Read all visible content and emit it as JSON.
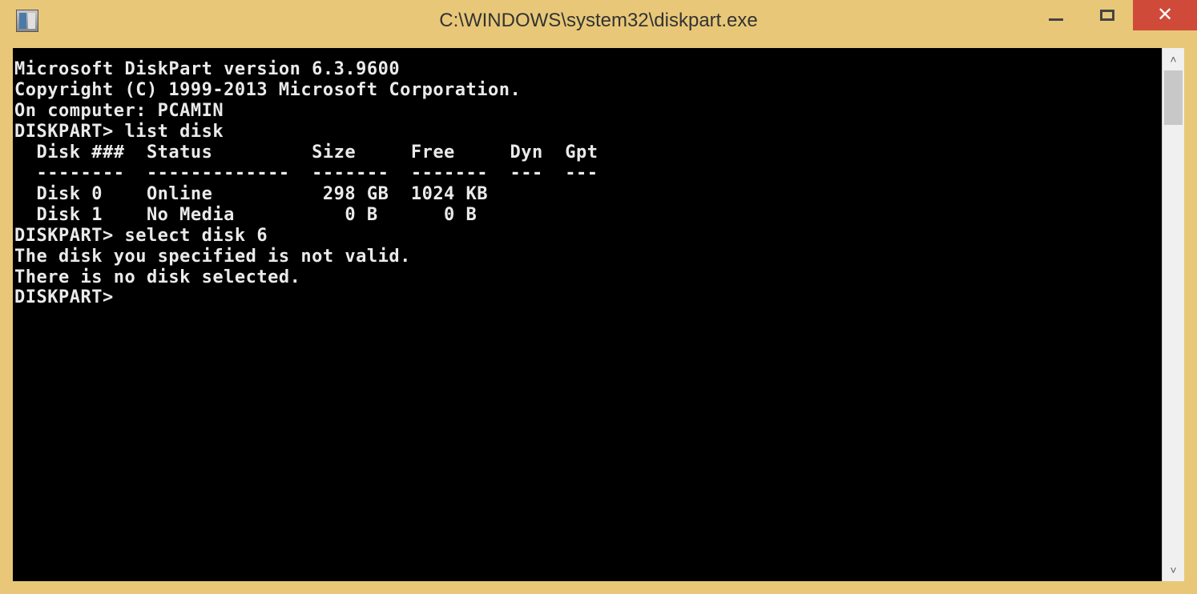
{
  "window": {
    "title": "C:\\WINDOWS\\system32\\diskpart.exe"
  },
  "terminal": {
    "version_line": "Microsoft DiskPart version 6.3.9600",
    "blank": "",
    "copyright_line": "Copyright (C) 1999-2013 Microsoft Corporation.",
    "computer_line": "On computer: PCAMIN",
    "prompt1": "DISKPART> list disk",
    "table_header": "  Disk ###  Status         Size     Free     Dyn  Gpt",
    "table_divider": "  --------  -------------  -------  -------  ---  ---",
    "table_row0": "  Disk 0    Online          298 GB  1024 KB",
    "table_row1": "  Disk 1    No Media          0 B      0 B",
    "prompt2": "DISKPART> select disk 6",
    "error1": "The disk you specified is not valid.",
    "error2": "There is no disk selected.",
    "prompt3": "DISKPART>"
  }
}
